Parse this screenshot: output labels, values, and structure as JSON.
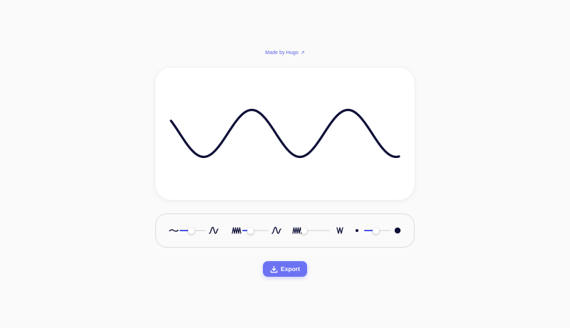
{
  "header": {
    "credit_label": "Made by Hugo",
    "credit_arrow": "↗"
  },
  "wave": {
    "stroke_color": "#0f1038",
    "background_color": "#ffffff"
  },
  "controls": [
    {
      "name": "amplitude",
      "left_icon": "flat-wave-icon",
      "right_icon": "tall-wave-icon",
      "value": 0.45
    },
    {
      "name": "frequency",
      "left_icon": "dense-wave-icon",
      "right_icon": "sparse-wave-icon",
      "value": 0.3
    },
    {
      "name": "sharpness",
      "left_icon": "zigzag-dense-icon",
      "right_icon": "zigzag-narrow-icon",
      "value": 0.0
    },
    {
      "name": "stroke-width",
      "left_icon": "small-dot-icon",
      "right_icon": "large-dot-icon",
      "value": 0.45
    }
  ],
  "export": {
    "label": "Export",
    "icon": "download-icon",
    "color": "#6c73f3"
  },
  "accent_color": "#4a55e0"
}
